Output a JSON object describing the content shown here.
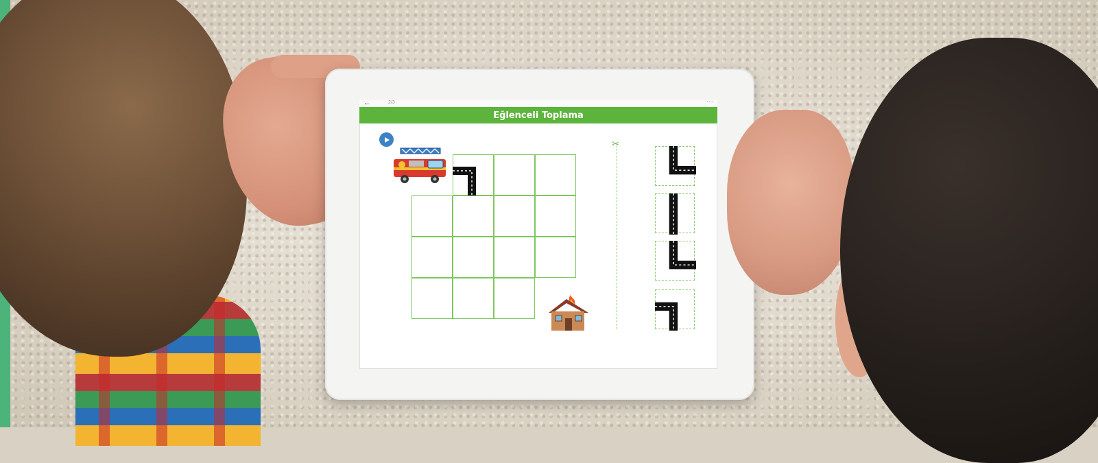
{
  "app": {
    "topbar": {
      "back_icon": "arrow-left-icon",
      "progress": "2/3",
      "more_icon": "more-dots-icon"
    },
    "title": "Eğlenceli Toplama",
    "play_icon": "play-icon",
    "colors": {
      "title_bar": "#5cb43c",
      "grid_line": "#7dc75e",
      "play_button": "#3d82c4",
      "road": "#111111"
    }
  },
  "game": {
    "vehicle_icon": "fire-truck-icon",
    "target_icon": "burning-house-icon",
    "divider_icon": "scissors-icon",
    "placed_tiles": [
      "road-corner-right-down-icon"
    ],
    "tile_tray": [
      "road-corner-up-right-icon",
      "road-straight-vertical-icon",
      "road-corner-up-right-icon",
      "road-corner-right-down-icon"
    ]
  }
}
